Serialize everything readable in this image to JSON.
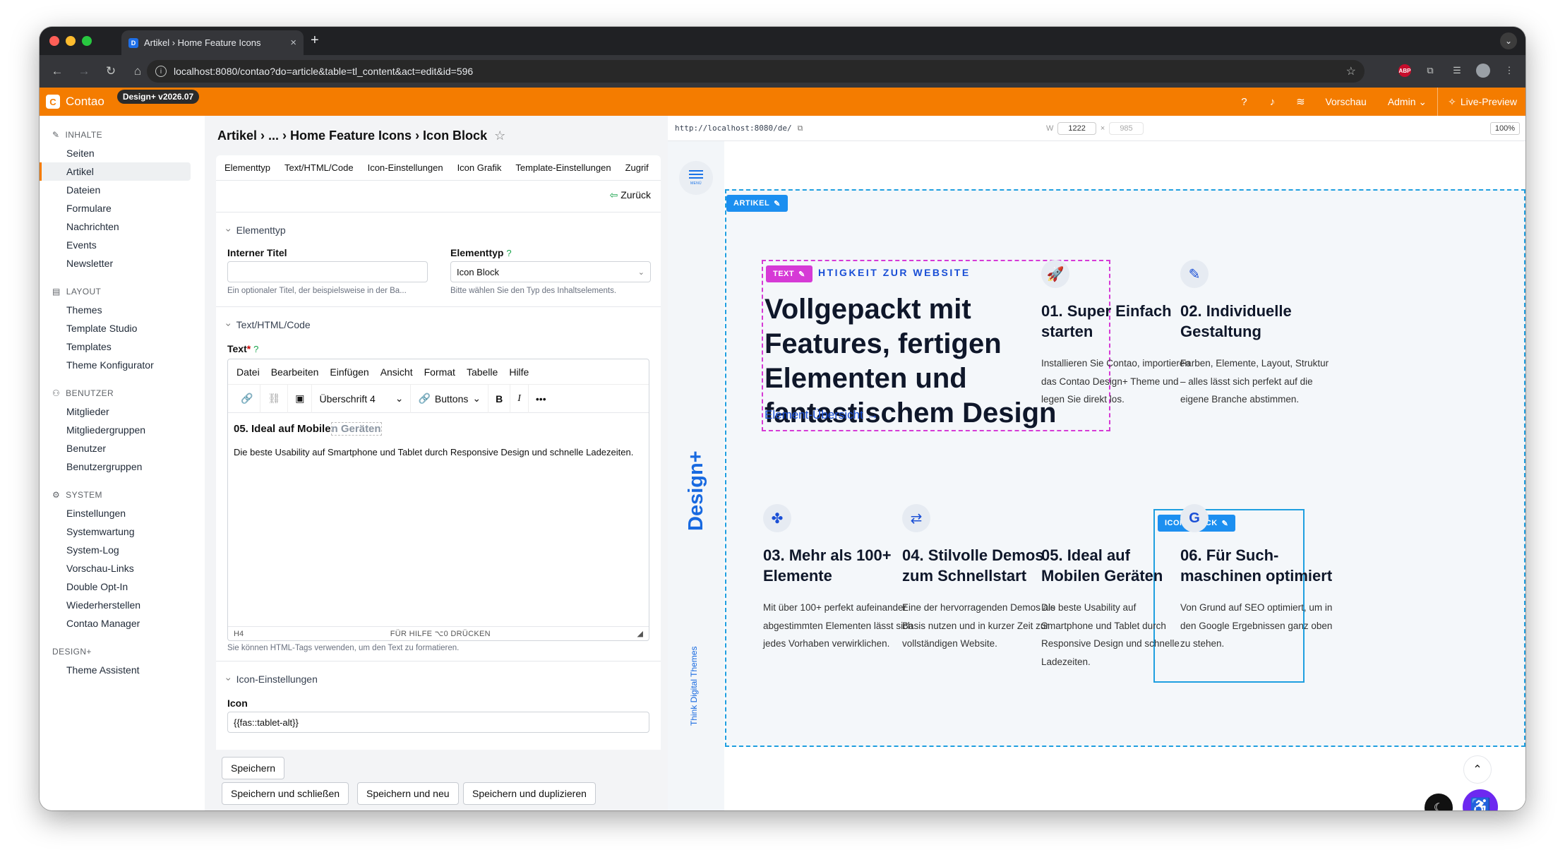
{
  "browser": {
    "tab_title": "Artikel › Home Feature Icons",
    "tab_close": "×",
    "new_tab": "+",
    "url": "localhost:8080/contao?do=article&table=tl_content&act=edit&id=596",
    "abp": "ABP"
  },
  "topbar": {
    "logo_text": "Contao",
    "version_badge": "Design+ v2026.07",
    "preview_label": "Vorschau",
    "admin_label": "Admin",
    "live_preview_label": "Live-Preview"
  },
  "sidebar": {
    "groups": [
      {
        "title": "INHALTE",
        "items": [
          "Seiten",
          "Artikel",
          "Dateien",
          "Formulare",
          "Nachrichten",
          "Events",
          "Newsletter"
        ]
      },
      {
        "title": "LAYOUT",
        "items": [
          "Themes",
          "Template Studio",
          "Templates",
          "Theme Konfigurator"
        ]
      },
      {
        "title": "BENUTZER",
        "items": [
          "Mitglieder",
          "Mitgliedergruppen",
          "Benutzer",
          "Benutzergruppen"
        ]
      },
      {
        "title": "SYSTEM",
        "items": [
          "Einstellungen",
          "Systemwartung",
          "System-Log",
          "Vorschau-Links",
          "Double Opt-In",
          "Wiederherstellen",
          "Contao Manager"
        ]
      },
      {
        "title": "DESIGN+",
        "items": [
          "Theme Assistent"
        ]
      }
    ],
    "active_item": "Artikel"
  },
  "editor": {
    "breadcrumb": "Artikel › ... › Home Feature Icons › Icon Block",
    "tabs": [
      "Elementtyp",
      "Text/HTML/Code",
      "Icon-Einstellungen",
      "Icon Grafik",
      "Template-Einstellungen",
      "Zugrif"
    ],
    "back_label": "Zurück",
    "section_elementtyp": "Elementtyp",
    "internal_title_label": "Interner Titel",
    "internal_title_value": "",
    "internal_title_hint": "Ein optionaler Titel, der beispielsweise in der Ba...",
    "elementtype_label": "Elementtyp",
    "elementtype_value": "Icon Block",
    "elementtype_hint": "Bitte wählen Sie den Typ des Inhaltselements.",
    "section_text": "Text/HTML/Code",
    "text_label": "Text",
    "rte_menu": [
      "Datei",
      "Bearbeiten",
      "Einfügen",
      "Ansicht",
      "Format",
      "Tabelle",
      "Hilfe"
    ],
    "rte_format": "Überschrift 4",
    "rte_buttons": "Buttons",
    "rte_heading_a": "05. Ideal auf Mobile",
    "rte_heading_b": "n Geräten",
    "rte_paragraph": "Die beste Usability auf Smartphone und Tablet durch Responsive Design und schnelle Ladezeiten.",
    "rte_status_left": "H4",
    "rte_status_center": "FÜR HILFE ⌥0 DRÜCKEN",
    "text_hint": "Sie können HTML-Tags verwenden, um den Text zu formatieren.",
    "section_icon": "Icon-Einstellungen",
    "icon_label": "Icon",
    "icon_value": "{{fas::tablet-alt}}",
    "buttons": {
      "save": "Speichern",
      "save_close": "Speichern und schließen",
      "save_new": "Speichern und neu",
      "save_duplicate": "Speichern und duplizieren"
    }
  },
  "preview": {
    "url": "http://localhost:8080/de/",
    "width_label": "W",
    "width": "1222",
    "times": "×",
    "height": "985",
    "zoom": "100%",
    "menu_label": "MENÜ",
    "brand": "Design+",
    "brand_credit": "Think Digital Themes",
    "badge_article": "ARTIKEL",
    "badge_text": "TEXT",
    "badge_icon_block": "ICON BLOCK",
    "kicker": "HTIGKEIT ZUR WEBSITE",
    "title": "Vollgepackt mit Features, fertigen Elementen und fantastischem Design",
    "link": "Element-Übersicht",
    "cards": [
      {
        "icon": "rocket-icon",
        "title": "01. Super Einfach starten",
        "text": "Installieren Sie Contao, importieren das Contao Design+ Theme und legen Sie direkt los."
      },
      {
        "icon": "brush-icon",
        "title": "02. Individuelle Gestaltung",
        "text": "Farben, Elemente, Layout, Struktur – alles lässt sich perfekt auf die eigene Branche abstimmen."
      },
      {
        "icon": "cubes-icon",
        "title": "03. Mehr als 100+ Elemente",
        "text": "Mit über 100+ perfekt aufeinander abgestimmten Elementen lässt sich jedes Vorhaben verwirklichen."
      },
      {
        "icon": "demos-icon",
        "title": "04. Stilvolle Demos zum Schnellstart",
        "text": "Eine der hervorragenden Demos als Basis nutzen und in kurzer Zeit zur vollständigen Website."
      },
      {
        "icon": "tablet-icon",
        "title": "05. Ideal auf Mobilen Geräten",
        "text": "Die beste Usability auf Smartphone und Tablet durch Responsive Design und schnelle Ladezeiten."
      },
      {
        "icon": "google-icon",
        "title": "06. Für Such-maschinen optimiert",
        "text": "Von Grund auf SEO optimiert, um in den Google Ergebnissen ganz oben zu stehen."
      }
    ]
  },
  "colors": {
    "brand_orange": "#f47c00",
    "accent_blue": "#1a4fd6",
    "selection_blue": "#1f9fe0",
    "text_badge": "#d63ad6",
    "accessibility": "#6d28f0"
  }
}
